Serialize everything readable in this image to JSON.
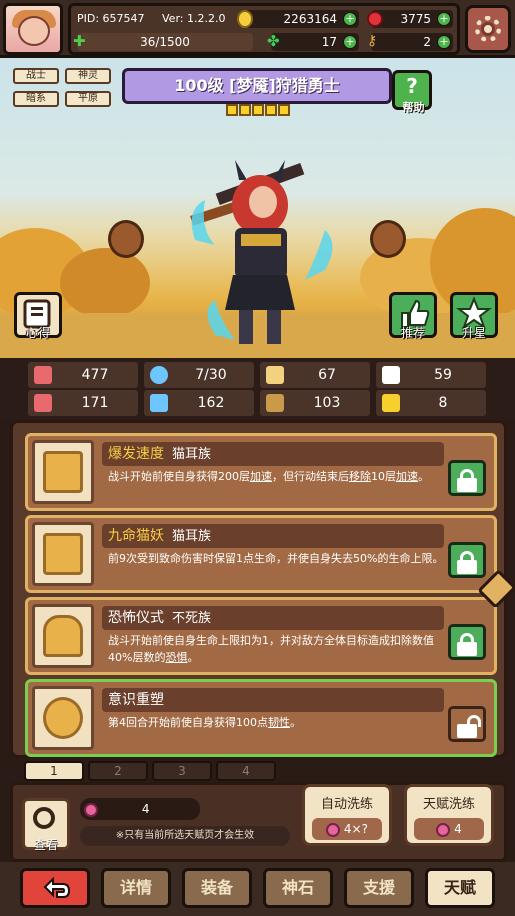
{
  "topbar": {
    "pid": "PID: 657547",
    "version": "Ver: 1.2.2.0",
    "gold": "2263164",
    "gems": "3775",
    "energy": "36/1500",
    "clover": "17",
    "keys": "2"
  },
  "tags": [
    "战士",
    "神灵",
    "暗系",
    "平原"
  ],
  "hero": {
    "title": "100级 [梦魇]狩猎勇士",
    "stars": 5,
    "help_label": "帮助"
  },
  "side_buttons": {
    "notes": "心得",
    "recommend": "推荐",
    "star_up": "升星"
  },
  "stats": [
    {
      "icon": "heart-icon",
      "value": "477",
      "color": "#e8696e"
    },
    {
      "icon": "water-drop-icon",
      "value": "7/30",
      "color": "#6ec6ff"
    },
    {
      "icon": "shield-icon",
      "value": "67",
      "color": "#f2d27e"
    },
    {
      "icon": "wing-icon",
      "value": "59",
      "color": "#ffffff"
    },
    {
      "icon": "fist-icon",
      "value": "171",
      "color": "#e8696e"
    },
    {
      "icon": "book-icon",
      "value": "162",
      "color": "#6ec6ff"
    },
    {
      "icon": "armor-icon",
      "value": "103",
      "color": "#c99a4a"
    },
    {
      "icon": "horseshoe-icon",
      "value": "8",
      "color": "#f6d12e"
    }
  ],
  "talents": [
    {
      "name": "爆发速度",
      "race": "猫耳族",
      "desc_parts": [
        "战斗开始前使自身获得200层",
        "加速",
        "，但行动结束后",
        "移除",
        "10层",
        "加速",
        "。"
      ],
      "locked": true
    },
    {
      "name": "九命猫妖",
      "race": "猫耳族",
      "desc_parts": [
        "前9次受到致命伤害时保留1点生命，并使自身失去50%的生命上限。"
      ],
      "locked": true
    },
    {
      "name": "恐怖仪式",
      "race": "不死族",
      "desc_parts": [
        "战斗开始前使自身生命上限扣为1，并对敌方全体目标造成扣除数值40%层数的",
        "恐惧",
        "。"
      ],
      "locked": true
    },
    {
      "name": "意识重塑",
      "race": "",
      "desc_parts": [
        "第4回合开始前使自身获得100点",
        "韧性",
        "。"
      ],
      "locked": false
    }
  ],
  "pages": [
    "1",
    "2",
    "3",
    "4"
  ],
  "bottom": {
    "search_label": "查看",
    "fruit_count": "4",
    "note": "※只有当前所选天赋页才会生效",
    "auto_wash": {
      "label": "自动洗练",
      "cost": "4×?"
    },
    "talent_wash": {
      "label": "天赋洗练",
      "cost": "4"
    }
  },
  "nav": [
    "详情",
    "装备",
    "神石",
    "支援",
    "天赋"
  ]
}
